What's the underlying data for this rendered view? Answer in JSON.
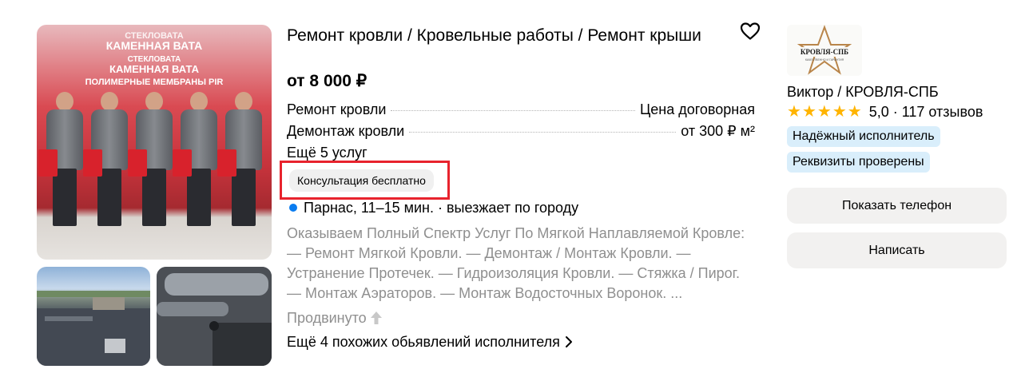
{
  "listing": {
    "title": "Ремонт кровли / Кровельные работы / Ремонт крыши",
    "price": "от 8 000 ₽",
    "services": [
      {
        "name": "Ремонт кровли",
        "price": "Цена договорная"
      },
      {
        "name": "Демонтаж кровли",
        "price": "от 300 ₽ м²"
      }
    ],
    "more_services": "Ещё 5 услуг",
    "consultation_badge": "Консультация бесплатно",
    "location": "Парнас, 11–15 мин. · выезжает по городу",
    "description": "Оказываем Полный Спектр Услуг По Мягкой Наплавляемой Кровле: — Ремонт Мягкой Кровли. — Демонтаж / Монтаж Кровли. — Устранение Протечек. — Гидроизоляция Кровли. — Стяжка / Пирог. — Монтаж Аэраторов. — Монтаж Водосточных Воронок. ...",
    "promoted": "Продвинуто",
    "similar_link": "Ещё 4 похожих обьявлений исполнителя"
  },
  "photo_banner": {
    "line1": "СТЕКЛОВАТА",
    "line2": "КАМЕННАЯ ВАТА",
    "line3": "СТЕКЛОВАТА",
    "line4": "КАМЕННАЯ ВАТА",
    "line5": "ПОЛИМЕРНЫЕ МЕМБРАНЫ PIR"
  },
  "seller": {
    "logo_text": "КРОВЛЯ-СПБ",
    "logo_subtext": "КАЧЕСТВЕННО И ГАРАНТИЯ",
    "name": "Виктор / КРОВЛЯ-СПБ",
    "rating_value": 5.0,
    "rating": "5,0",
    "reviews": "· 117 отзывов",
    "badges": [
      "Надёжный исполнитель",
      "Реквизиты проверены"
    ]
  },
  "actions": {
    "show_phone": "Показать телефон",
    "write": "Написать"
  },
  "colors": {
    "accent_red": "#e8232d",
    "star": "#ffb400",
    "badge_bg": "#d9eefb",
    "location_dot": "#0a7cf0",
    "muted_text": "#8f8f8f"
  },
  "icons": [
    "heart-icon",
    "star-icon",
    "arrow-up-icon",
    "chevron-right-icon"
  ]
}
